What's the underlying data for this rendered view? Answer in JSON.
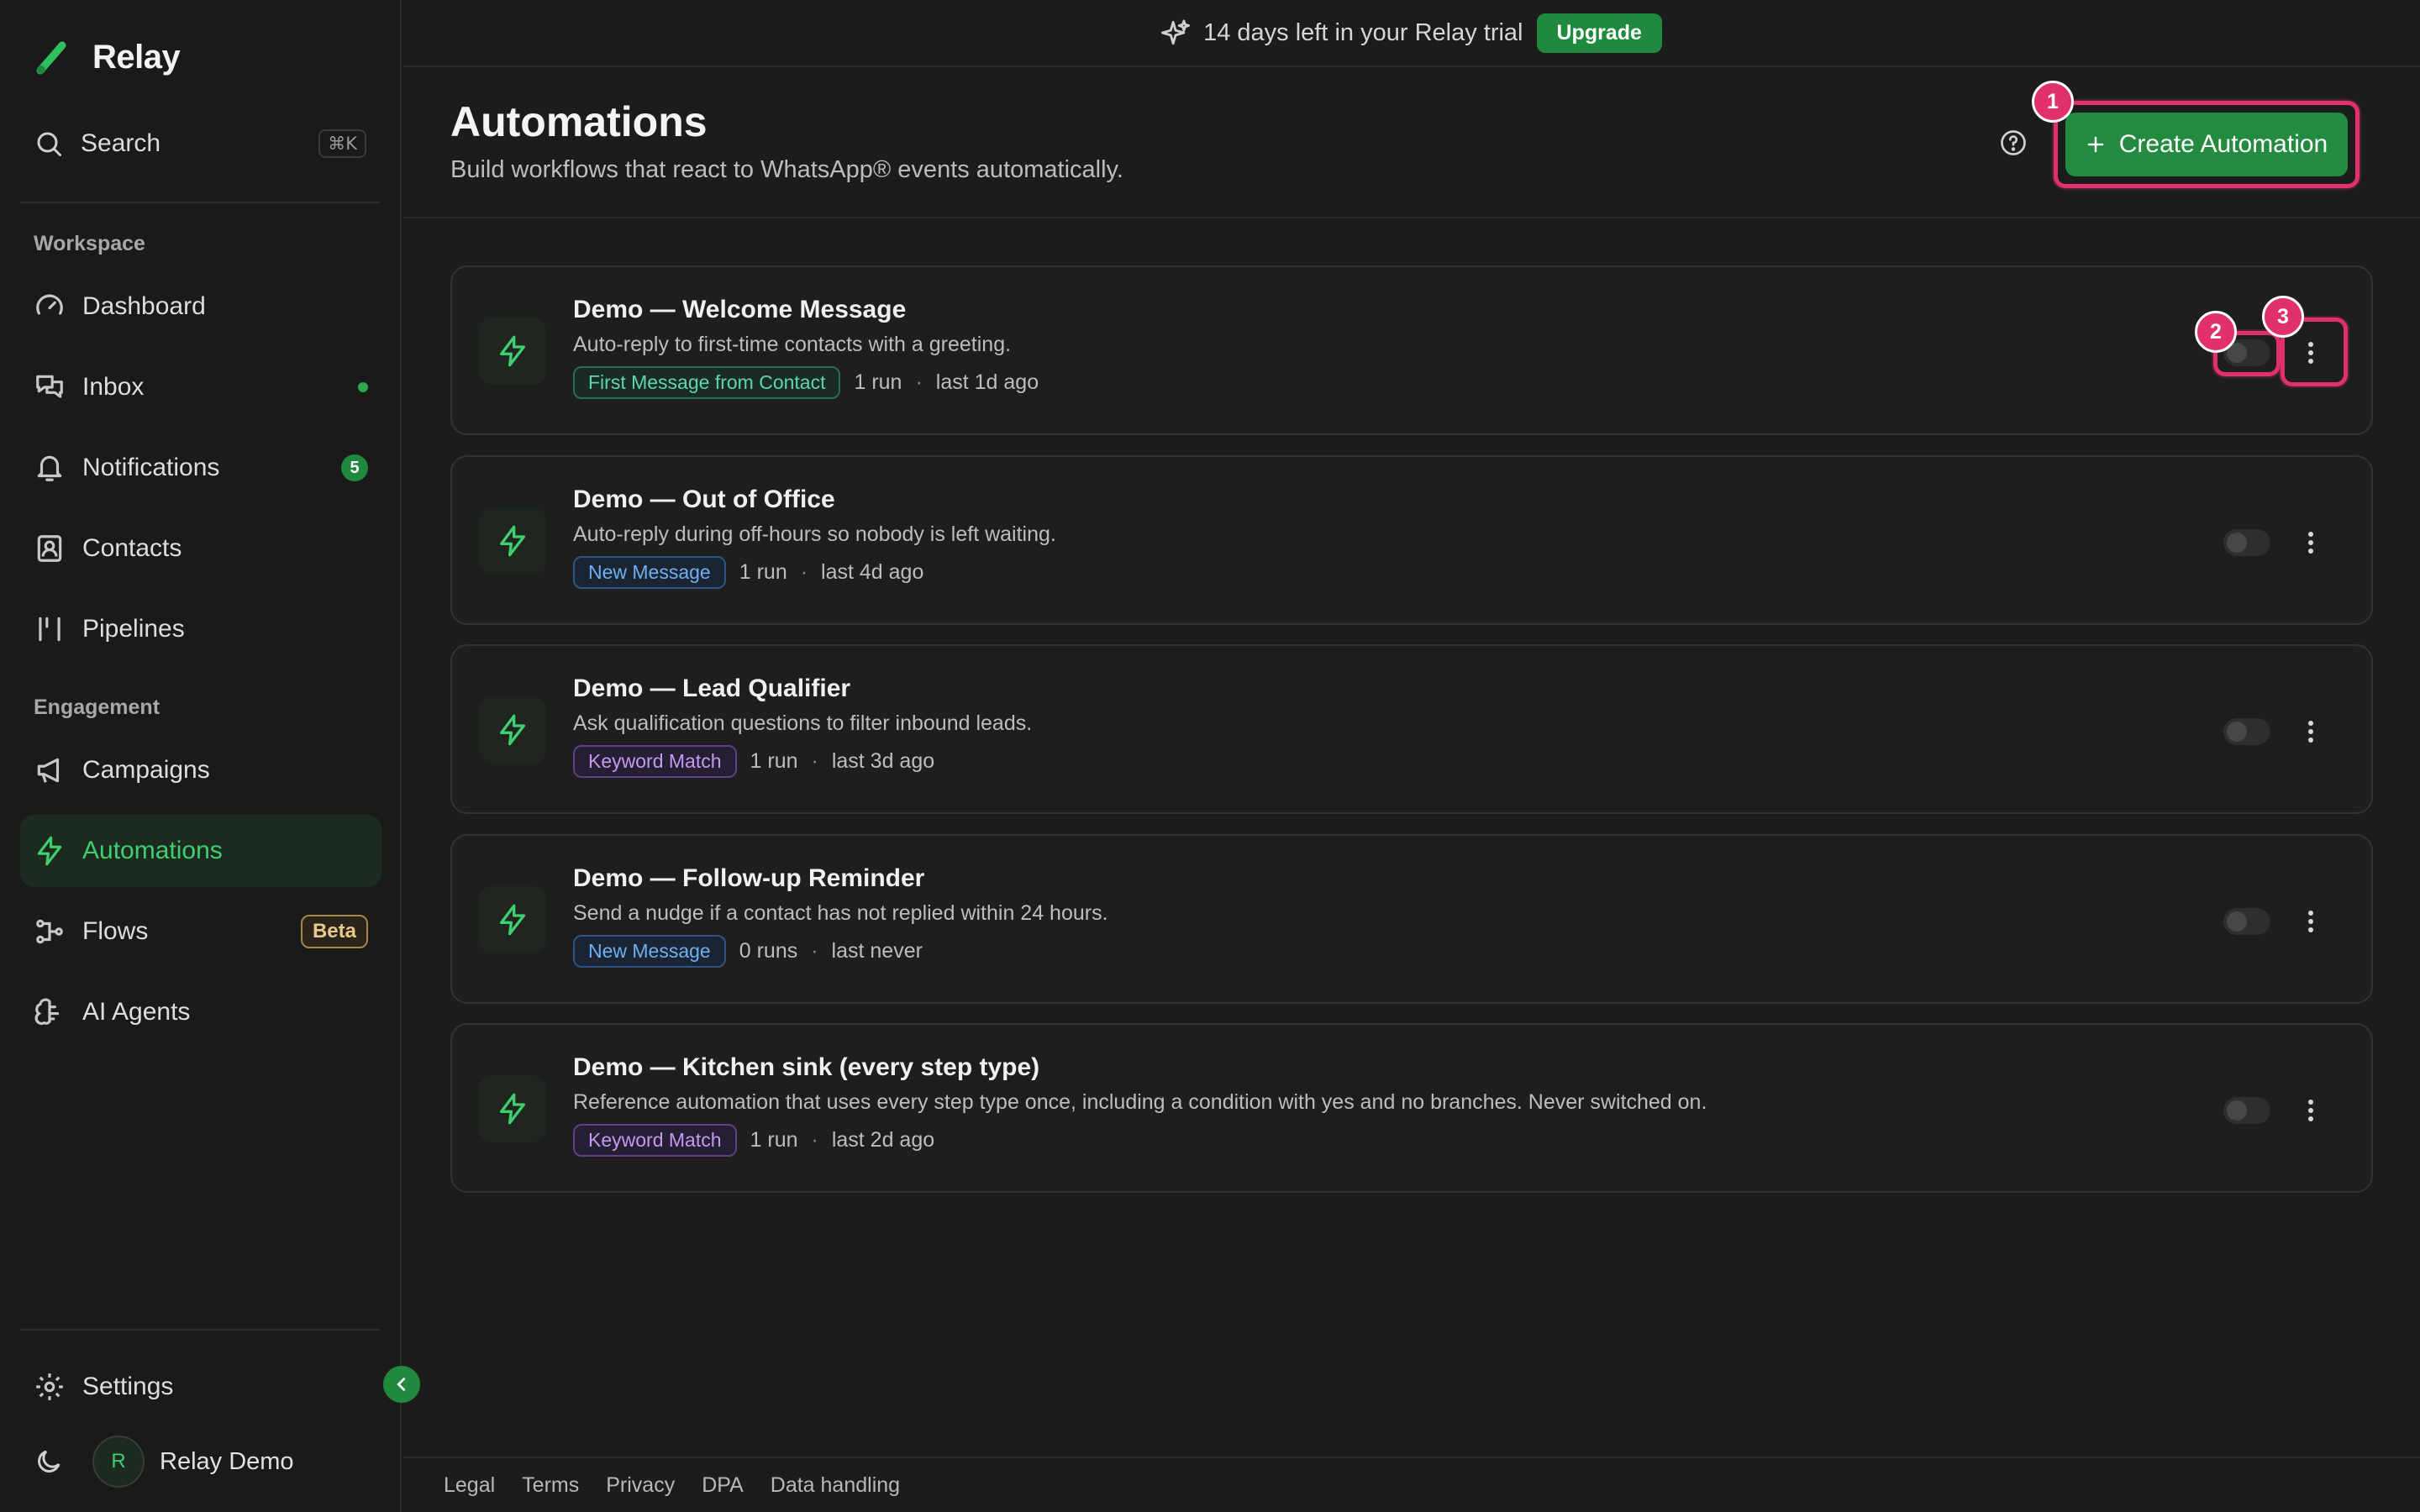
{
  "app": {
    "name": "Relay"
  },
  "sidebar": {
    "search": {
      "label": "Search",
      "shortcut": "⌘K"
    },
    "sections": [
      {
        "label": "Workspace"
      },
      {
        "label": "Engagement"
      }
    ],
    "items": [
      {
        "label": "Dashboard",
        "icon": "gauge-icon"
      },
      {
        "label": "Inbox",
        "icon": "chat-bubbles-icon",
        "indicator": "dot"
      },
      {
        "label": "Notifications",
        "icon": "bell-icon",
        "count": "5"
      },
      {
        "label": "Contacts",
        "icon": "contact-card-icon"
      },
      {
        "label": "Pipelines",
        "icon": "pipeline-icon"
      },
      {
        "label": "Campaigns",
        "icon": "megaphone-icon"
      },
      {
        "label": "Automations",
        "icon": "lightning-icon",
        "active": true
      },
      {
        "label": "Flows",
        "icon": "flow-icon",
        "badge": "Beta"
      },
      {
        "label": "AI Agents",
        "icon": "brain-icon"
      }
    ],
    "settings_label": "Settings",
    "user": {
      "initial": "R",
      "name": "Relay Demo"
    }
  },
  "banner": {
    "text": "14 days left in your Relay trial",
    "cta": "Upgrade"
  },
  "header": {
    "title": "Automations",
    "subtitle": "Build workflows that react to WhatsApp® events automatically.",
    "create_label": "Create Automation"
  },
  "markers": [
    "1",
    "2",
    "3"
  ],
  "automations": [
    {
      "title": "Demo — Welcome Message",
      "description": "Auto-reply to first-time contacts with a greeting.",
      "trigger": "First Message from Contact",
      "trigger_color": "teal",
      "runs": "1 run",
      "last": "last 1d ago",
      "enabled": false
    },
    {
      "title": "Demo — Out of Office",
      "description": "Auto-reply during off-hours so nobody is left waiting.",
      "trigger": "New Message",
      "trigger_color": "blue",
      "runs": "1 run",
      "last": "last 4d ago",
      "enabled": false
    },
    {
      "title": "Demo — Lead Qualifier",
      "description": "Ask qualification questions to filter inbound leads.",
      "trigger": "Keyword Match",
      "trigger_color": "purple",
      "runs": "1 run",
      "last": "last 3d ago",
      "enabled": false
    },
    {
      "title": "Demo — Follow-up Reminder",
      "description": "Send a nudge if a contact has not replied within 24 hours.",
      "trigger": "New Message",
      "trigger_color": "blue",
      "runs": "0 runs",
      "last": "last never",
      "enabled": false
    },
    {
      "title": "Demo — Kitchen sink (every step type)",
      "description": "Reference automation that uses every step type once, including a condition with yes and no branches. Never switched on.",
      "trigger": "Keyword Match",
      "trigger_color": "purple",
      "runs": "1 run",
      "last": "last 2d ago",
      "enabled": false
    }
  ],
  "footer": {
    "links": [
      "Legal",
      "Terms",
      "Privacy",
      "DPA",
      "Data handling"
    ]
  },
  "colors": {
    "accent": "#238b3f",
    "accent_text": "#3fcf6f",
    "highlight": "#e2306c",
    "background": "#1c1c1c"
  }
}
